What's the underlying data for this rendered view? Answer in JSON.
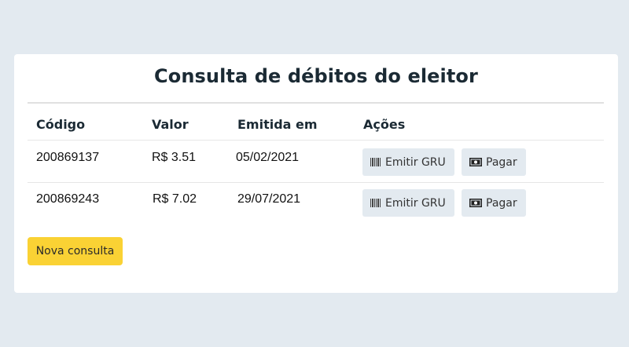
{
  "page": {
    "title": "Consulta de débitos do eleitor"
  },
  "table": {
    "headers": [
      "Código",
      "Valor",
      "Emitida em",
      "Ações"
    ],
    "rows": [
      {
        "codigo": "200869137",
        "valor": "R$ 3.51",
        "emitida": "05/02/2021",
        "emitir_label": "Emitir GRU",
        "pagar_label": "Pagar"
      },
      {
        "codigo": "200869243",
        "valor": "R$ 7.02",
        "emitida": "29/07/2021",
        "emitir_label": "Emitir GRU",
        "pagar_label": "Pagar"
      }
    ]
  },
  "actions": {
    "nova_consulta_label": "Nova consulta"
  },
  "icons": {
    "emitir": "barcode-icon",
    "pagar": "money-bill-icon"
  },
  "colors": {
    "background": "#e3eaf0",
    "primary_button": "#fad234",
    "secondary_button": "#e3eaf0"
  }
}
